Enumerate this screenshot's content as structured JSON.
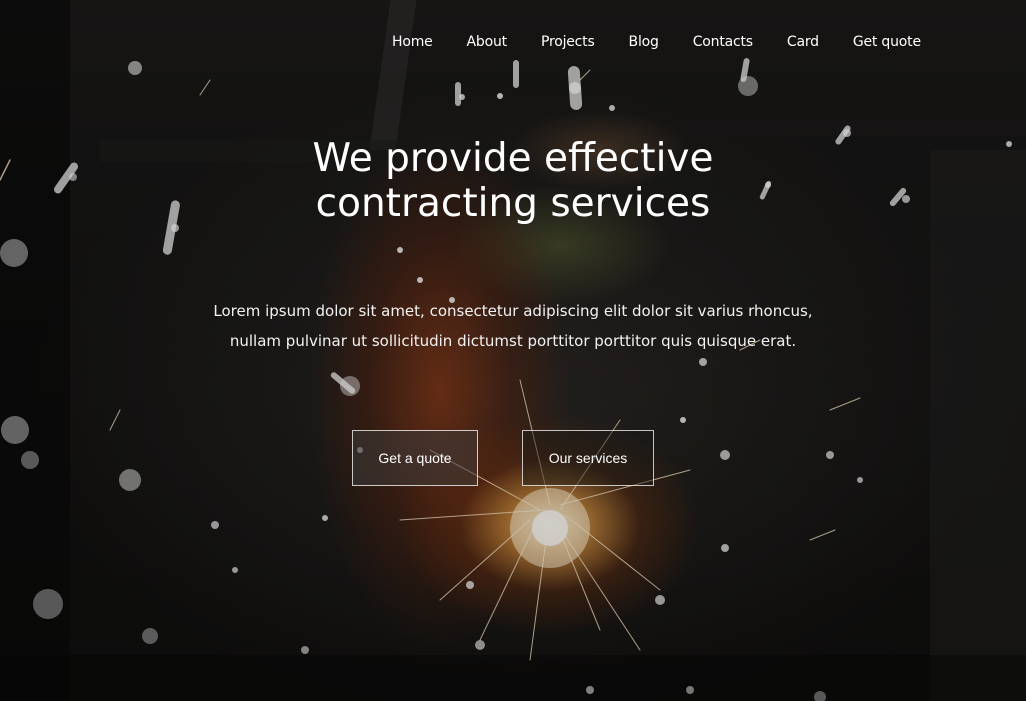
{
  "nav": {
    "items": [
      "Home",
      "About",
      "Projects",
      "Blog",
      "Contacts",
      "Card",
      "Get quote"
    ]
  },
  "hero": {
    "headline_line1": "We provide effective",
    "headline_line2": "contracting services",
    "lead_line1": "Lorem ipsum dolor sit amet, consectetur adipiscing elit dolor sit varius rhoncus,",
    "lead_line2": "nullam pulvinar ut sollicitudin dictumst porttitor porttitor quis quisque erat.",
    "primary_button": "Get a quote",
    "secondary_button": "Our services"
  },
  "colors": {
    "text": "#ffffff",
    "spark_core": "#ffe7b8",
    "overalls_accent": "#c4521e"
  }
}
